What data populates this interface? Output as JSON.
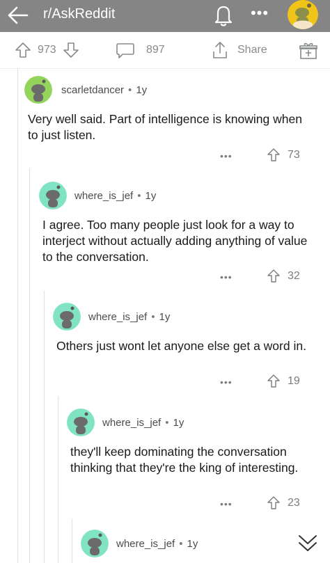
{
  "header": {
    "subreddit": "r/AskReddit",
    "more": "•••"
  },
  "post_actions": {
    "upvotes": "973",
    "comments": "897",
    "share_label": "Share"
  },
  "comments": [
    {
      "author": "scarletdancer",
      "age": "1y",
      "body": "Very well said. Part of intelligence is knowing when to just listen.",
      "score": "73",
      "more": "•••",
      "avatar_color": "#94d45c"
    },
    {
      "author": "where_is_jef",
      "age": "1y",
      "body": "I agree. Too many people just look for a way to interject without actually adding anything of value to the conversation.",
      "score": "32",
      "more": "•••",
      "avatar_color": "#7fe3c4"
    },
    {
      "author": "where_is_jef",
      "age": "1y",
      "body": "Others just wont let anyone else get a word in.",
      "score": "19",
      "more": "•••",
      "avatar_color": "#7fe3c4"
    },
    {
      "author": "where_is_jef",
      "age": "1y",
      "body": "they'll keep dominating the conversation thinking that they're the king of interesting.",
      "score": "23",
      "more": "•••",
      "avatar_color": "#7fe3c4"
    },
    {
      "author": "where_is_jef",
      "age": "1y",
      "avatar_color": "#7fe3c4"
    }
  ]
}
